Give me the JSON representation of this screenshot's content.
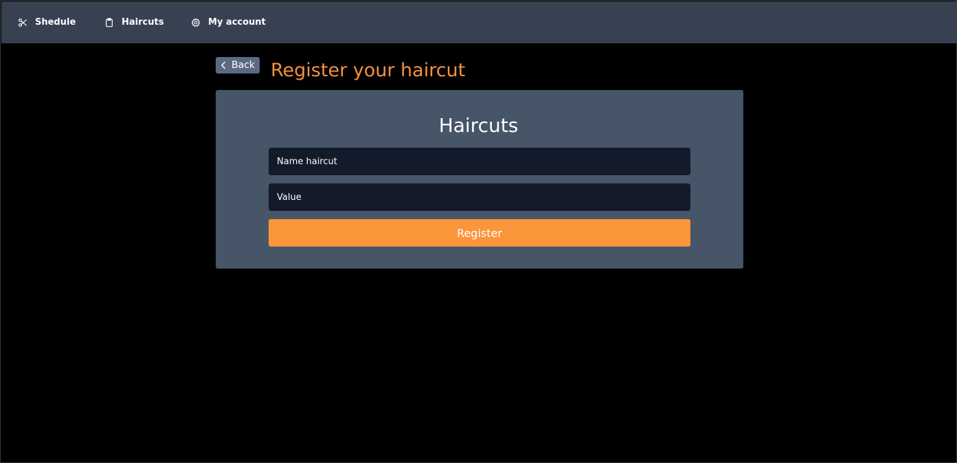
{
  "nav": {
    "items": [
      {
        "label": "Shedule",
        "icon": "scissors-icon"
      },
      {
        "label": "Haircuts",
        "icon": "clipboard-icon"
      },
      {
        "label": "My account",
        "icon": "gear-icon"
      }
    ]
  },
  "back": {
    "label": "Back",
    "icon": "chevron-left-icon"
  },
  "page": {
    "title": "Register your haircut"
  },
  "form": {
    "title": "Haircuts",
    "name_field": {
      "placeholder": "Name haircut",
      "value": ""
    },
    "value_field": {
      "placeholder": "Value",
      "value": ""
    },
    "submit_label": "Register"
  },
  "colors": {
    "topbar": "#384152",
    "background": "#000000",
    "card": "#465568",
    "accent": "#f7913a",
    "input": "#131a2a",
    "back_button": "#5b6a82"
  }
}
